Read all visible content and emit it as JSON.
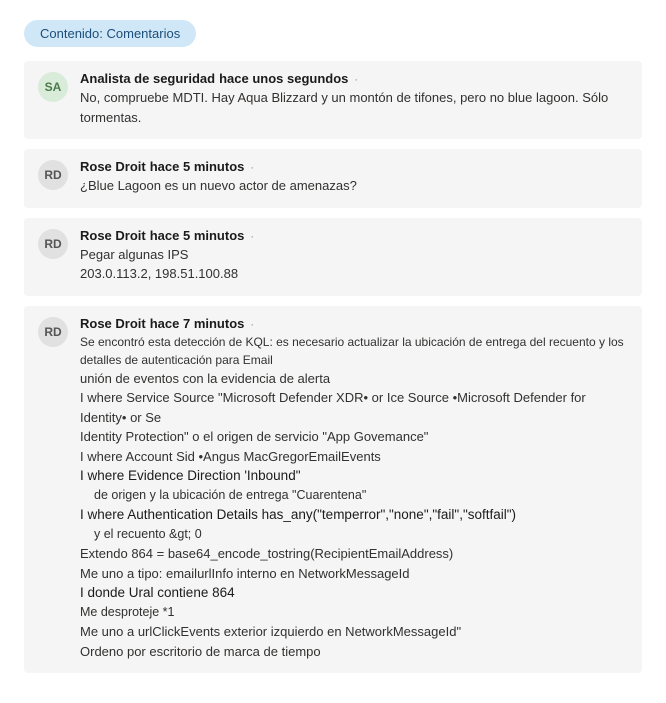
{
  "header": {
    "pill_label": "Contenido: Comentarios"
  },
  "comments": [
    {
      "avatar": "SA",
      "avatar_class": "sa",
      "author": "Analista de seguridad",
      "timestamp": "hace unos segundos",
      "lines": [
        {
          "text": "No, compruebe MDTI. Hay Aqua Blizzard y un montón de tifones, pero no blue lagoon. Sólo tormentas."
        }
      ]
    },
    {
      "avatar": "RD",
      "avatar_class": "",
      "author": "Rose Droit",
      "timestamp": "hace 5 minutos",
      "lines": [
        {
          "text": "¿Blue Lagoon es un nuevo actor de amenazas?"
        }
      ]
    },
    {
      "avatar": "RD",
      "avatar_class": "",
      "author": "Rose Droit",
      "timestamp": "hace 5 minutos",
      "lines": [
        {
          "text": "Pegar algunas IPS"
        },
        {
          "text": "203.0.113.2, 198.51.100.88",
          "cls": "ips"
        }
      ]
    },
    {
      "avatar": "RD",
      "avatar_class": "",
      "author": "Rose Droit",
      "timestamp": "hace 7 minutos",
      "lines": [
        {
          "text": "Se encontró esta detección de KQL: es necesario actualizar la ubicación de entrega del recuento y los detalles de autenticación para Email",
          "cls": "small"
        },
        {
          "text": "unión de eventos con la evidencia de alerta"
        },
        {
          "text": "I where Service Source \"Microsoft Defender XDR• or Ice Source •Microsoft Defender for Identity• or Se"
        },
        {
          "text": "Identity Protection\" o el origen de servicio \"App Govemance\""
        },
        {
          "text": "I where Account Sid •Angus MacGregorEmailEvents"
        },
        {
          "text": "I where Evidence Direction 'Inbound\"",
          "cls": "emph"
        },
        {
          "text": "de origen y la ubicación de entrega \"Cuarentena\"",
          "cls": "sub"
        },
        {
          "text": "I where Authentication Details has_any(\"temperror\",\"none\",\"fail\",\"softfail\")",
          "cls": "emph"
        },
        {
          "text": "y el recuento &gt; 0",
          "cls": "sub"
        },
        {
          "text": "Extendo 864 = base64_encode_tostring(RecipientEmailAddress)"
        },
        {
          "text": "Me uno a tipo: emailurlInfo interno en NetworkMessageId"
        },
        {
          "text": "I donde Ural contiene 864",
          "cls": "emph"
        },
        {
          "text": "Me desproteje  *1",
          "cls": "sub-noindent"
        },
        {
          "text": "Me uno a urlClickEvents exterior izquierdo en NetworkMessageId\""
        },
        {
          "text": "Ordeno por escritorio de marca de tiempo"
        }
      ]
    }
  ]
}
